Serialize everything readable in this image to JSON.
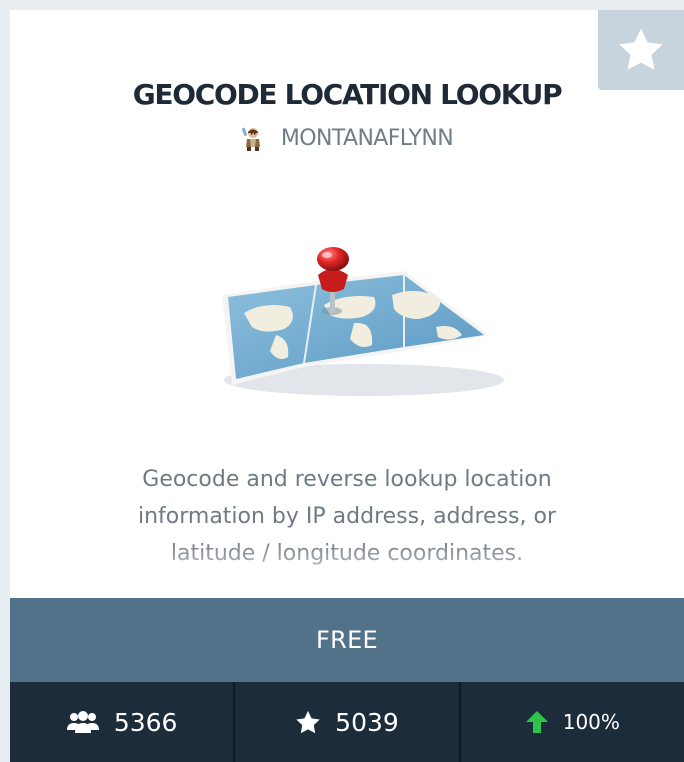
{
  "api": {
    "title": "GEOCODE LOCATION LOOKUP",
    "author": "MONTANAFLYNN",
    "description": "Geocode and reverse lookup location information by IP address, address, or latitude / longitude coordinates.",
    "price": "FREE"
  },
  "stats": {
    "subscribers": "5366",
    "stars": "5039",
    "success_rate": "100%"
  },
  "icons": {
    "favorite": "star-icon",
    "author": "author-avatar-icon",
    "hero": "map-pin-icon",
    "subscribers": "users-icon",
    "stars": "star-icon",
    "success": "arrow-up-icon"
  },
  "colors": {
    "price_bar": "#52728a",
    "stats_bar": "#1c2c3a",
    "success_arrow": "#2ec44a",
    "fav_button": "#c7d4de"
  }
}
